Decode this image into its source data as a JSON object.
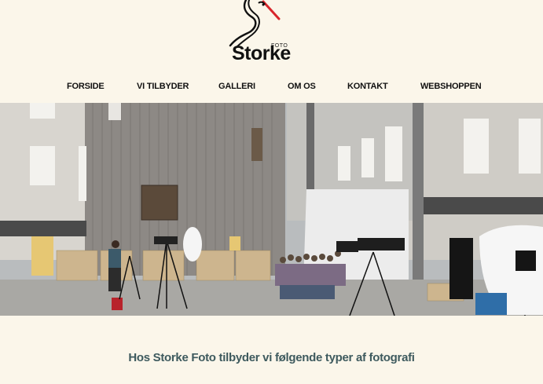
{
  "brand": {
    "name": "Storke",
    "sub": "FOTO",
    "colors": {
      "accent": "#d8262b",
      "text": "#111111",
      "heading": "#3e5a5e",
      "background": "#fbf6ea"
    }
  },
  "nav": {
    "items": [
      {
        "label": "FORSIDE"
      },
      {
        "label": "VI TILBYDER"
      },
      {
        "label": "GALLERI"
      },
      {
        "label": "OM OS"
      },
      {
        "label": "KONTAKT"
      },
      {
        "label": "WEBSHOPPEN"
      }
    ]
  },
  "hero": {
    "image": "courtyard-photo-studio-scene"
  },
  "main": {
    "heading": "Hos Storke Foto tilbyder vi følgende typer af fotografi"
  }
}
